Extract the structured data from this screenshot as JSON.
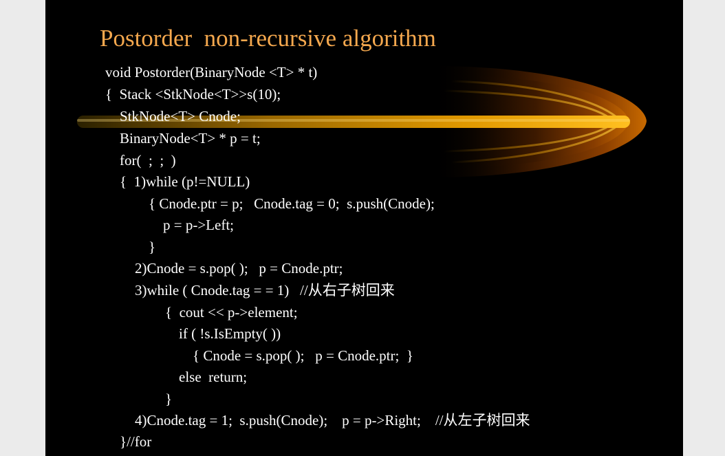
{
  "slide": {
    "title": "Postorder  non-recursive algorithm",
    "colors": {
      "background": "#000000",
      "title": "#f5a84e",
      "text": "#ffffff",
      "accent": "#f0a010"
    },
    "code_lines": [
      "void Postorder(BinaryNode <T> * t)",
      "{  Stack <StkNode<T>>s(10);",
      "StkNode<T> Cnode;",
      "BinaryNode<T> * p = t;",
      "for(  ;  ;  )",
      "{  1)while (p!=NULL)",
      "{ Cnode.ptr = p;   Cnode.tag = 0;  s.push(Cnode);",
      "p = p->Left;",
      "}",
      "2)Cnode = s.pop( );   p = Cnode.ptr;",
      "3)while ( Cnode.tag = = 1)   //从右子树回来",
      "{  cout << p->element;",
      "if ( !s.IsEmpty( ))",
      "{ Cnode = s.pop( );   p = Cnode.ptr;  }",
      "else  return;",
      "}",
      "4)Cnode.tag = 1;  s.push(Cnode);    p = p->Right;    //从左子树回来",
      "}//for"
    ]
  }
}
